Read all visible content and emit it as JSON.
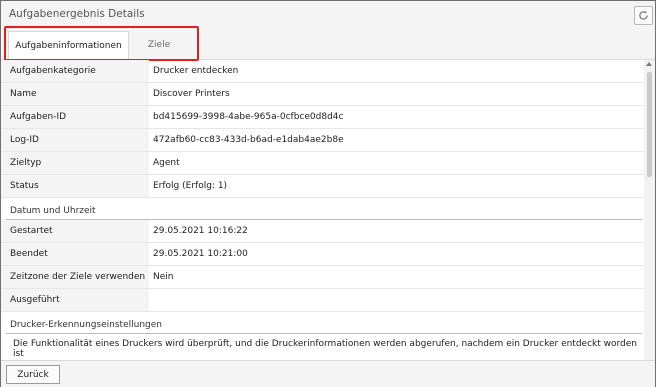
{
  "window": {
    "title": "Aufgabenergebnis Details",
    "refresh_icon": "refresh-icon"
  },
  "tabs": [
    {
      "label": "Aufgabeninformationen",
      "active": true
    },
    {
      "label": "Ziele",
      "active": false
    }
  ],
  "info_rows": [
    {
      "label": "Aufgabenkategorie",
      "value": "Drucker entdecken"
    },
    {
      "label": "Name",
      "value": "Discover Printers"
    },
    {
      "label": "Aufgaben-ID",
      "value": "bd415699-3998-4abe-965a-0cfbce0d8d4c"
    },
    {
      "label": "Log-ID",
      "value": "472afb60-cc83-433d-b6ad-e1dab4ae2b8e"
    },
    {
      "label": "Zieltyp",
      "value": "Agent"
    },
    {
      "label": "Status",
      "value": "Erfolg (Erfolg: 1)"
    }
  ],
  "datetime": {
    "header": "Datum und Uhrzeit",
    "rows": [
      {
        "label": "Gestartet",
        "value": "29.05.2021 10:16:22"
      },
      {
        "label": "Beendet",
        "value": "29.05.2021 10:21:00"
      },
      {
        "label": "Zeitzone der Ziele verwenden",
        "value": "Nein"
      },
      {
        "label": "Ausgeführt",
        "value": ""
      }
    ]
  },
  "printer_settings": {
    "header": "Drucker-Erkennungseinstellungen",
    "description": "Die Funktionalität eines Druckers wird überprüft, und die Druckerinformationen werden abgerufen, nachdem ein Drucker entdeckt worden ist"
  },
  "footer": {
    "back_label": "Zurück"
  },
  "colors": {
    "highlight": "#e02020",
    "label_bg": "#f4f4f4"
  }
}
